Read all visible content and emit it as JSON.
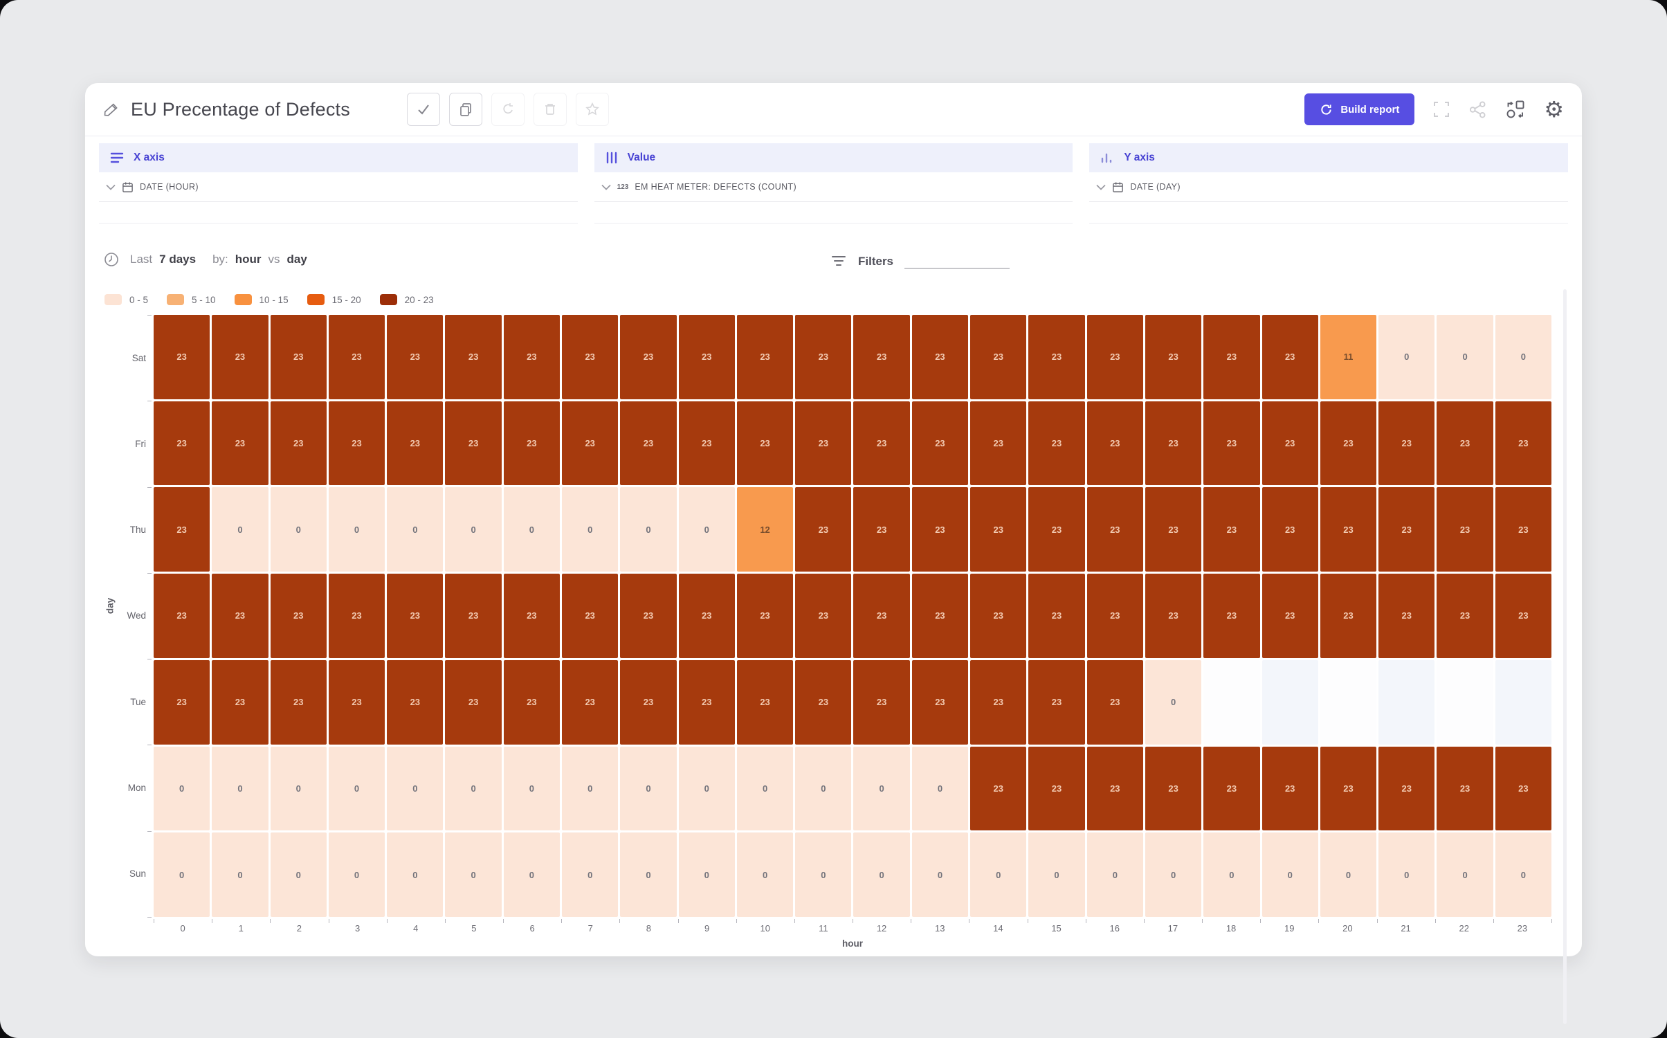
{
  "header": {
    "title": "EU Precentage of Defects",
    "build_report": "Build report"
  },
  "panels": [
    {
      "label": "X axis",
      "field": "DATE (HOUR)"
    },
    {
      "label": "Value",
      "prefix": "123",
      "field": "EM HEAT METER: DEFECTS (COUNT)"
    },
    {
      "label": "Y axis",
      "field": "DATE (DAY)"
    }
  ],
  "controls": {
    "last": "Last",
    "period": "7 days",
    "by": "by:",
    "x_unit": "hour",
    "vs": "vs",
    "y_unit": "day",
    "filters": "Filters"
  },
  "chart_data": {
    "type": "heatmap",
    "xlabel": "hour",
    "ylabel": "day",
    "x": [
      0,
      1,
      2,
      3,
      4,
      5,
      6,
      7,
      8,
      9,
      10,
      11,
      12,
      13,
      14,
      15,
      16,
      17,
      18,
      19,
      20,
      21,
      22,
      23
    ],
    "rows": [
      "Sat",
      "Fri",
      "Thu",
      "Wed",
      "Tue",
      "Mon",
      "Sun"
    ],
    "series": [
      {
        "name": "Sat",
        "values": [
          23,
          23,
          23,
          23,
          23,
          23,
          23,
          23,
          23,
          23,
          23,
          23,
          23,
          23,
          23,
          23,
          23,
          23,
          23,
          23,
          11,
          0,
          0,
          0
        ]
      },
      {
        "name": "Fri",
        "values": [
          23,
          23,
          23,
          23,
          23,
          23,
          23,
          23,
          23,
          23,
          23,
          23,
          23,
          23,
          23,
          23,
          23,
          23,
          23,
          23,
          23,
          23,
          23,
          23
        ]
      },
      {
        "name": "Thu",
        "values": [
          23,
          0,
          0,
          0,
          0,
          0,
          0,
          0,
          0,
          0,
          12,
          23,
          23,
          23,
          23,
          23,
          23,
          23,
          23,
          23,
          23,
          23,
          23,
          23
        ]
      },
      {
        "name": "Wed",
        "values": [
          23,
          23,
          23,
          23,
          23,
          23,
          23,
          23,
          23,
          23,
          23,
          23,
          23,
          23,
          23,
          23,
          23,
          23,
          23,
          23,
          23,
          23,
          23,
          23
        ]
      },
      {
        "name": "Tue",
        "values": [
          23,
          23,
          23,
          23,
          23,
          23,
          23,
          23,
          23,
          23,
          23,
          23,
          23,
          23,
          23,
          23,
          23,
          0,
          null,
          null,
          null,
          null,
          null,
          null
        ]
      },
      {
        "name": "Mon",
        "values": [
          0,
          0,
          0,
          0,
          0,
          0,
          0,
          0,
          0,
          0,
          0,
          0,
          0,
          0,
          23,
          23,
          23,
          23,
          23,
          23,
          23,
          23,
          23,
          23
        ]
      },
      {
        "name": "Sun",
        "values": [
          0,
          0,
          0,
          0,
          0,
          0,
          0,
          0,
          0,
          0,
          0,
          0,
          0,
          0,
          0,
          0,
          0,
          0,
          0,
          0,
          0,
          0,
          0,
          0
        ]
      }
    ],
    "legend": [
      {
        "label": "0 - 5",
        "color": "#fce3d4"
      },
      {
        "label": "5 - 10",
        "color": "#f7b174"
      },
      {
        "label": "10 - 15",
        "color": "#f8913f"
      },
      {
        "label": "15 - 20",
        "color": "#e65c10"
      },
      {
        "label": "20 - 23",
        "color": "#9c2e08"
      }
    ],
    "legend_position": "top-left",
    "bucket_thresholds": [
      5,
      10,
      15,
      20
    ],
    "cell_colors": [
      "#fce5d7",
      "#f7b174",
      "#f89a4e",
      "#e65c10",
      "#a63a0d"
    ],
    "cell_text_colors": [
      "#73737b",
      "#7d5233",
      "#7a4e2d",
      "#ffe0cc",
      "#f2c9b0"
    ],
    "empty_cell_colors": [
      "#fdfdfe",
      "#f3f6fb"
    ],
    "accent_color": "#574ee2"
  }
}
